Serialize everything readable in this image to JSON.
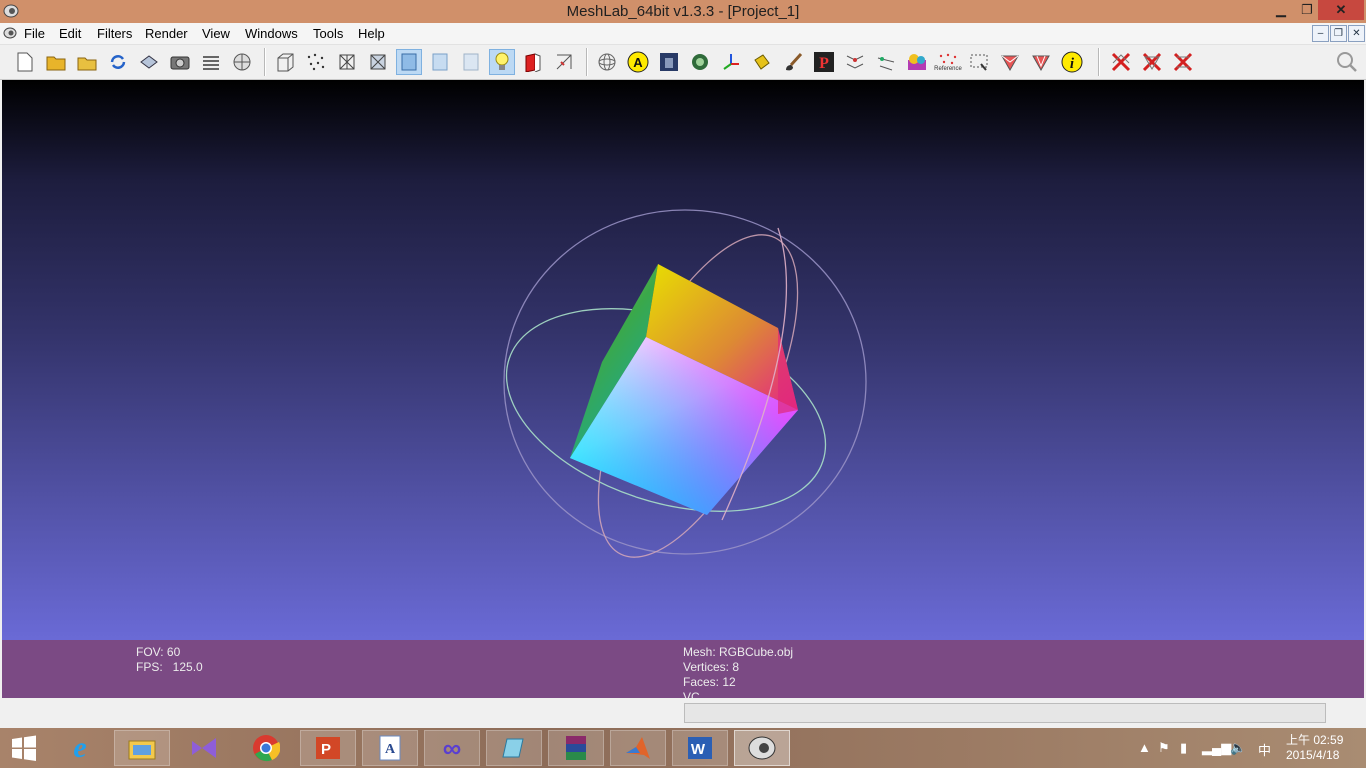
{
  "window": {
    "title": "MeshLab_64bit v1.3.3 - [Project_1]",
    "min_glyph": "▁",
    "max_glyph": "❐",
    "close_glyph": "✕"
  },
  "menu": {
    "items": [
      "File",
      "Edit",
      "Filters",
      "Render",
      "View",
      "Windows",
      "Tools",
      "Help"
    ],
    "mdi": [
      "–",
      "❐",
      "✕"
    ]
  },
  "toolbar": {
    "active_tools": [
      "smooth-shading-tool",
      "lighting-tool"
    ],
    "reference_label": "Reference"
  },
  "info": {
    "fov_label": "FOV: 60",
    "fps_label": "FPS:   125.0",
    "mesh_label": "Mesh: RGBCube.obj",
    "vertices_label": "Vertices: 8",
    "faces_label": "Faces: 12",
    "vc_label": "VC"
  },
  "status": {
    "progress": 0
  },
  "taskbar": {
    "apps": [
      {
        "name": "start-button",
        "glyph": "⊞"
      },
      {
        "name": "internet-explorer",
        "glyph": "e"
      },
      {
        "name": "file-explorer",
        "glyph": "▤"
      },
      {
        "name": "visual-studio",
        "glyph": "▶"
      },
      {
        "name": "chrome",
        "glyph": "◉"
      },
      {
        "name": "powerpoint",
        "glyph": "P"
      },
      {
        "name": "document-viewer",
        "glyph": "A"
      },
      {
        "name": "infinity-app",
        "glyph": "∞"
      },
      {
        "name": "app-blue",
        "glyph": "◆"
      },
      {
        "name": "winrar",
        "glyph": "▦"
      },
      {
        "name": "matlab",
        "glyph": "▲"
      },
      {
        "name": "word",
        "glyph": "W"
      },
      {
        "name": "meshlab",
        "glyph": "◐"
      }
    ],
    "ime": "中",
    "clock_time": "上午 02:59",
    "clock_date": "2015/4/18"
  },
  "colors": {
    "titlebar": "#d0906a",
    "info_panel": "#7b4a84",
    "viewport_top": "#000000",
    "viewport_bottom": "#6a6ad6"
  }
}
